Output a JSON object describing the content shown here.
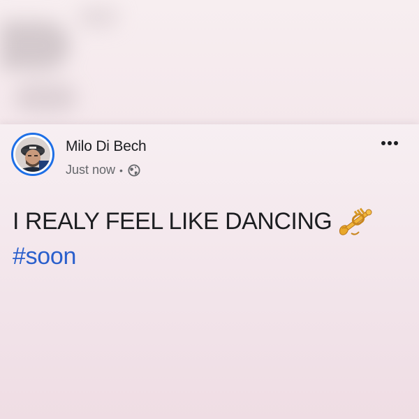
{
  "post": {
    "author_name": "Milo Di Bech",
    "timestamp": "Just now",
    "separator": "•",
    "audience_icon": "globe-icon",
    "more_options_icon": "more-horizontal-icon",
    "text": "I REALY FEEL LIKE DANCING",
    "emoji_icon": "trumpet-icon",
    "hashtag": "#soon"
  },
  "colors": {
    "avatar_ring": "#1e6fe6",
    "hashtag": "#2a5fcc",
    "primary_text": "#1c1e21",
    "secondary_text": "#65676b",
    "background": "#f3e5ea"
  }
}
